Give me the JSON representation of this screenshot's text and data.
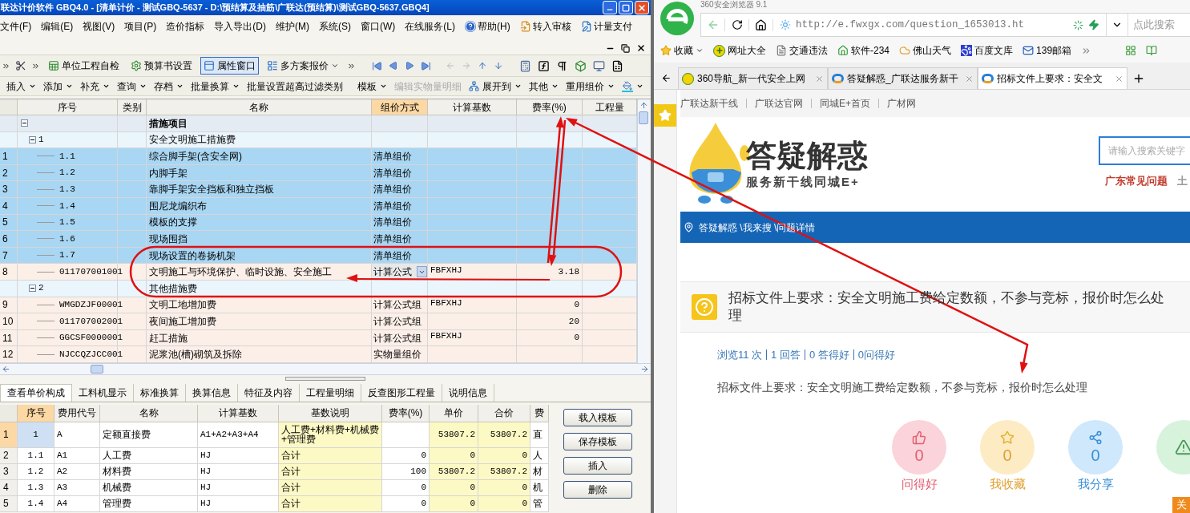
{
  "app": {
    "title": "联达计价软件 GBQ4.0 - [清单计价 - 测试GBQ-5637 - D:\\预结算及抽筋\\广联达(预结算)\\测试GBQ-5637.GBQ4]",
    "menu": [
      {
        "label": "文件(F)",
        "kind": "plain"
      },
      {
        "label": "编辑(E)",
        "kind": "plain"
      },
      {
        "label": "视图(V)",
        "kind": "plain"
      },
      {
        "label": "项目(P)",
        "kind": "plain"
      },
      {
        "label": "造价指标",
        "kind": "plain"
      },
      {
        "label": "导入导出(D)",
        "kind": "plain"
      },
      {
        "label": "维护(M)",
        "kind": "plain"
      },
      {
        "label": "系统(S)",
        "kind": "plain"
      },
      {
        "label": "窗口(W)",
        "kind": "plain"
      },
      {
        "label": "在线服务(L)",
        "kind": "plain"
      },
      {
        "label": "帮助(H)",
        "kind": "help"
      },
      {
        "label": "转入审核",
        "kind": "review"
      },
      {
        "label": "计量支付",
        "kind": "payment"
      }
    ],
    "toolbar1": [
      {
        "label": "单位工程自检",
        "kind": "check",
        "selected": false
      },
      {
        "label": "预算书设置",
        "kind": "settings",
        "selected": false
      },
      {
        "label": "属性窗口",
        "kind": "window",
        "selected": true
      },
      {
        "label": "多方案报价",
        "kind": "plans",
        "selected": false
      }
    ],
    "toolbar2": [
      {
        "kind": "menu",
        "label": "插入",
        "dropdown": true,
        "disabled": false
      },
      {
        "kind": "menu",
        "label": "添加",
        "dropdown": true,
        "disabled": false
      },
      {
        "kind": "menu",
        "label": "补充",
        "dropdown": true,
        "disabled": false
      },
      {
        "kind": "menu",
        "label": "查询",
        "dropdown": true,
        "disabled": false
      },
      {
        "kind": "menu",
        "label": "存档",
        "dropdown": true,
        "disabled": false
      },
      {
        "kind": "menu",
        "label": "批量换算",
        "dropdown": true,
        "disabled": false
      },
      {
        "kind": "menu",
        "label": "批量设置超高过滤类别",
        "dropdown": false,
        "disabled": false
      },
      {
        "kind": "separator"
      },
      {
        "kind": "menu",
        "label": "模板",
        "dropdown": true,
        "disabled": false
      },
      {
        "kind": "menu",
        "label": "编辑实物量明细",
        "dropdown": false,
        "disabled": true
      },
      {
        "kind": "expand",
        "label": "展开到",
        "dropdown": true,
        "disabled": false
      },
      {
        "kind": "menu",
        "label": "其他",
        "dropdown": true,
        "disabled": false
      },
      {
        "kind": "menu",
        "label": "重用组价",
        "dropdown": true,
        "disabled": false
      },
      {
        "kind": "paint",
        "dropdown": true,
        "disabled": false
      }
    ],
    "grid": {
      "columns": [
        {
          "label": "序号",
          "selected": false
        },
        {
          "label": "类别",
          "selected": false
        },
        {
          "label": "名称",
          "selected": false
        },
        {
          "label": "组价方式",
          "selected": true
        },
        {
          "label": "计算基数",
          "selected": false
        },
        {
          "label": "费率(%)",
          "selected": false
        },
        {
          "label": "工程量",
          "selected": false
        }
      ],
      "rows": [
        {
          "kind": "group",
          "code": "",
          "name": "措施项目",
          "expanded": true,
          "children": [
            {
              "kind": "group",
              "code": "1",
              "name": "安全文明施工措施费",
              "expanded": true,
              "children": [
                {
                  "kind": "item",
                  "number": "1",
                  "code": "1.1",
                  "name": "综合脚手架(含安全网)",
                  "method": "清单组价",
                  "selected": true,
                  "editing": false
                },
                {
                  "kind": "item",
                  "number": "2",
                  "code": "1.2",
                  "name": "内脚手架",
                  "method": "清单组价",
                  "selected": true,
                  "editing": false
                },
                {
                  "kind": "item",
                  "number": "3",
                  "code": "1.3",
                  "name": "靠脚手架安全挡板和独立挡板",
                  "method": "清单组价",
                  "selected": true,
                  "editing": false
                },
                {
                  "kind": "item",
                  "number": "4",
                  "code": "1.4",
                  "name": "围尼龙编织布",
                  "method": "清单组价",
                  "selected": true,
                  "editing": false
                },
                {
                  "kind": "item",
                  "number": "5",
                  "code": "1.5",
                  "name": "模板的支撑",
                  "method": "清单组价",
                  "selected": true,
                  "editing": false
                },
                {
                  "kind": "item",
                  "number": "6",
                  "code": "1.6",
                  "name": "现场围挡",
                  "method": "清单组价",
                  "selected": true,
                  "editing": false
                },
                {
                  "kind": "item",
                  "number": "7",
                  "code": "1.7",
                  "name": "现场设置的卷扬机架",
                  "method": "清单组价",
                  "selected": true,
                  "editing": false
                },
                {
                  "kind": "item",
                  "number": "8",
                  "code": "011707001001",
                  "name": "文明施工与环境保护、临时设施、安全施工",
                  "method": "计算公式",
                  "base": "FBFXHJ",
                  "rate": "3.18",
                  "selected": false,
                  "editing": true
                }
              ]
            },
            {
              "kind": "group",
              "code": "2",
              "name": "其他措施费",
              "expanded": true,
              "children": [
                {
                  "kind": "item",
                  "number": "9",
                  "code": "WMGDZJF00001",
                  "name": "文明工地增加费",
                  "method": "计算公式组",
                  "base": "FBFXHJ",
                  "rate": "0",
                  "selected": false,
                  "editing": false
                },
                {
                  "kind": "item",
                  "number": "10",
                  "code": "011707002001",
                  "name": "夜间施工增加费",
                  "method": "计算公式组",
                  "rate": "20",
                  "selected": false,
                  "editing": false
                },
                {
                  "kind": "item",
                  "number": "11",
                  "code": "GGCSF0000001",
                  "name": "赶工措施",
                  "method": "计算公式组",
                  "base": "FBFXHJ",
                  "rate": "0",
                  "selected": false,
                  "editing": false
                },
                {
                  "kind": "item",
                  "number": "12",
                  "code": "NJCCQZJCC001",
                  "name": "泥浆池(槽)砌筑及拆除",
                  "method": "实物量组价",
                  "selected": false,
                  "editing": false
                }
              ]
            }
          ]
        }
      ]
    },
    "tabs": [
      {
        "label": "查看单价构成",
        "selected": true
      },
      {
        "label": "工料机显示",
        "selected": false
      },
      {
        "label": "标准换算",
        "selected": false
      },
      {
        "label": "换算信息",
        "selected": false
      },
      {
        "label": "特征及内容",
        "selected": false
      },
      {
        "label": "工程量明细",
        "selected": false
      },
      {
        "label": "反查图形工程量",
        "selected": false
      },
      {
        "label": "说明信息",
        "selected": false
      }
    ],
    "detail": {
      "columns": [
        {
          "label": "序号",
          "highlighted": false
        },
        {
          "label": "费用代号",
          "highlighted": false
        },
        {
          "label": "名称",
          "highlighted": false
        },
        {
          "label": "计算基数",
          "highlighted": false
        },
        {
          "label": "基数说明",
          "highlighted": true
        },
        {
          "label": "费率(%)",
          "highlighted": false
        },
        {
          "label": "单价",
          "highlighted": true
        },
        {
          "label": "合价",
          "highlighted": true
        },
        {
          "label": "费",
          "highlighted": false
        }
      ],
      "rows": [
        {
          "number": "1",
          "selected": true,
          "cells": [
            "1",
            "A",
            "定额直接费",
            "A1+A2+A3+A4",
            "人工费+材料费+机械费+管理费",
            "",
            "53807.2",
            "53807.2",
            "直"
          ]
        },
        {
          "number": "2",
          "selected": false,
          "cells": [
            "1.1",
            "A1",
            "人工费",
            "HJ",
            "合计",
            "0",
            "0",
            "0",
            "人"
          ]
        },
        {
          "number": "3",
          "selected": false,
          "cells": [
            "1.2",
            "A2",
            "材料费",
            "HJ",
            "合计",
            "100",
            "53807.2",
            "53807.2",
            "材"
          ]
        },
        {
          "number": "4",
          "selected": false,
          "cells": [
            "1.3",
            "A3",
            "机械费",
            "HJ",
            "合计",
            "0",
            "0",
            "0",
            "机"
          ]
        },
        {
          "number": "5",
          "selected": false,
          "cells": [
            "1.4",
            "A4",
            "管理费",
            "HJ",
            "合计",
            "0",
            "0",
            "0",
            "管"
          ]
        }
      ]
    },
    "buttons": [
      "载入模板",
      "保存模板",
      "插入",
      "删除"
    ]
  },
  "browser": {
    "title": "360安全浏览器 9.1",
    "url": "http://e.fwxgx.com/question_1653013.ht",
    "search_placeholder": "点此搜索",
    "bookmarks": [
      {
        "label": "收藏",
        "kind": "favorites"
      },
      {
        "label": "网址大全",
        "kind": "nav"
      },
      {
        "label": "交通违法",
        "kind": "page"
      },
      {
        "label": "软件-234",
        "kind": "soft"
      },
      {
        "label": "佛山天气",
        "kind": "weather"
      },
      {
        "label": "百度文库",
        "kind": "paw"
      },
      {
        "label": "139邮箱",
        "kind": "mail"
      }
    ],
    "tabs": [
      {
        "label": "360导航_新一代安全上网",
        "kind": "nav",
        "selected": false
      },
      {
        "label": "答疑解惑_广联达服务新干",
        "kind": "site",
        "selected": false
      },
      {
        "label": "招标文件上要求：安全文",
        "kind": "site",
        "selected": true
      }
    ],
    "site": {
      "top_links": [
        "广联达新干线",
        "广联达官网",
        "同城E+首页",
        "广材网"
      ],
      "logo_title": "答疑解惑",
      "logo_subtitle": "服务新干线同城E+",
      "search_placeholder": "请输入搜索关键字",
      "hot_links": [
        {
          "label": "广东常见问题",
          "color": "#c0392b"
        },
        {
          "label": "土",
          "color": "#999999"
        }
      ],
      "breadcrumb": "答疑解惑 \\我来搜 \\问题详情",
      "question": "招标文件上要求：安全文明施工费给定数额，不参与竞标，报价时怎么处理",
      "stats": [
        "浏览11 次",
        "1 回答",
        "0 答得好",
        "0问得好"
      ],
      "body": "招标文件上要求：安全文明施工费给定数额，不参与竞标，报价时怎么处理",
      "actions": [
        {
          "kind": "like",
          "count": "0",
          "label": "问得好",
          "color": "#fad4da"
        },
        {
          "kind": "star",
          "count": "0",
          "label": "我收藏",
          "color": "#fdebc4"
        },
        {
          "kind": "share",
          "count": "0",
          "label": "我分享",
          "color": "#cfe8fb"
        },
        {
          "kind": "report",
          "color": "#d8f3dc"
        }
      ],
      "float_button": "关"
    }
  }
}
